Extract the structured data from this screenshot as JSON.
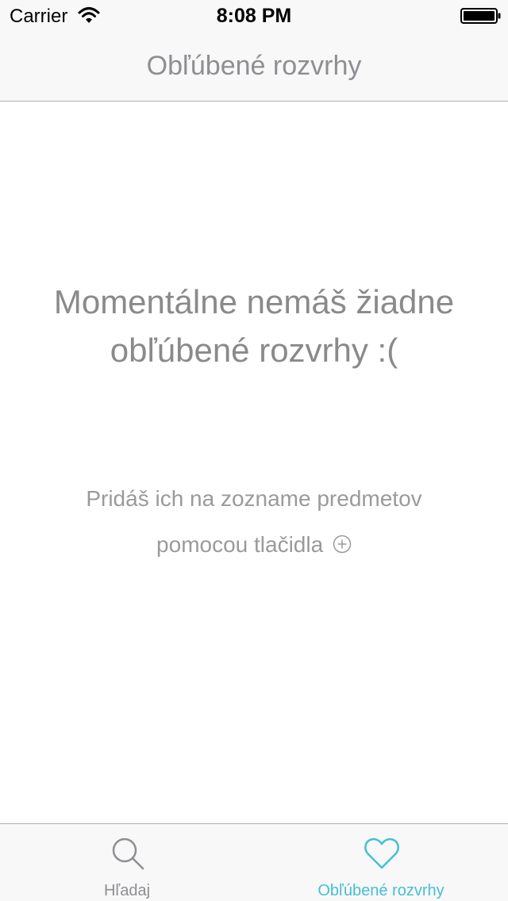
{
  "status_bar": {
    "carrier": "Carrier",
    "time": "8:08 PM",
    "wifi_icon": "wifi-icon",
    "battery_icon": "battery-full-icon"
  },
  "nav_bar": {
    "title": "Obľúbené rozvrhy"
  },
  "empty_state": {
    "title": "Momentálne nemáš žiadne obľúbené rozvrhy :(",
    "hint_line_1": "Pridáš ich na zozname predmetov",
    "hint_line_2": "pomocou tlačidla",
    "hint_icon": "circle-plus-icon"
  },
  "tab_bar": {
    "tabs": [
      {
        "label": "Hľadaj",
        "icon": "search-icon",
        "selected": false
      },
      {
        "label": "Obľúbené rozvrhy",
        "icon": "heart-icon",
        "selected": true
      }
    ]
  },
  "colors": {
    "accent": "#45bfd6",
    "inactive": "#8e8e93",
    "bar_background": "#f8f8f8",
    "separator": "#b2b2b2"
  }
}
